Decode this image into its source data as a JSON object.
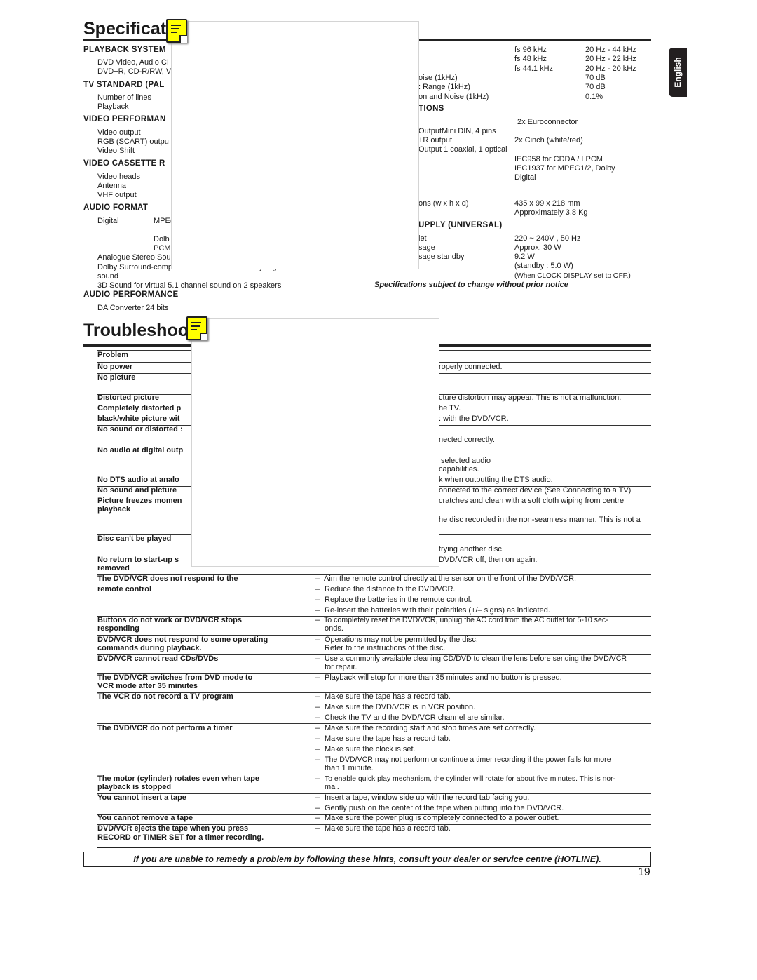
{
  "language_tab": "English",
  "specs": {
    "title": "Specificati",
    "left": [
      "PLAYBACK SYSTEM",
      "DVD Video, Audio CI",
      "DVD+R, CD-R/RW, V",
      "TV STANDARD (PAL",
      "Number of lines",
      "Playback",
      "VIDEO PERFORMAN",
      "Video output",
      "RGB (SCART) outpu",
      "Video Shift",
      "VIDEO CASSETTE R",
      "Video heads",
      "Antenna",
      "VHF output",
      "AUDIO FORMAT",
      "Digital",
      "MPE(",
      "Dolb",
      "PCM",
      "Analogue Stereo Sou",
      "Dolby Surround-compatible downmix from Dolby Digital multi channel",
      "sound",
      "3D Sound for virtual 5.1 channel sound on 2 speakers",
      "AUDIO PERFORMANCE",
      "DA Converter  24 bits"
    ],
    "right_labels": [
      "oise (1kHz)",
      ": Range (1kHz)",
      "on and Noise (1kHz)",
      "TIONS",
      "OutputMini DIN, 4 pins",
      "+R output",
      "Output  1 coaxial, 1 optical",
      "ons (w x h x d)",
      "UPPLY (UNIVERSAL)",
      "let",
      "sage",
      "sage standby"
    ],
    "values": [
      "fs 96 kHz",
      "fs 48 kHz",
      "fs 44.1 kHz",
      "20 Hz - 44 kHz",
      "20 Hz - 22 kHz",
      "20 Hz - 20 kHz",
      "70 dB",
      "70 dB",
      "0.1%",
      "2x Euroconnector",
      "2x Cinch (white/red)",
      "IEC958 for CDDA / LPCM",
      "IEC1937 for MPEG1/2, Dolby",
      "Digital",
      "435 x 99 x 218 mm",
      "Approximately 3.8 Kg",
      "220 ~ 240V , 50 Hz",
      "Approx. 30 W",
      "9.2 W",
      "(standby : 5.0 W)",
      "(When CLOCK DISPLAY set to OFF.)"
    ],
    "notice": "Specifications subject to change without prior notice"
  },
  "trouble": {
    "title": "Troubleshoot",
    "header": "Problem",
    "upper_problems": [
      "No power",
      "No picture",
      "Distorted picture",
      "Completely distorted p",
      "black/white picture wit",
      "No sound or distorted :",
      "No audio at digital outp",
      "No DTS audio at analo",
      "No sound and picture",
      "Picture freezes momen",
      "playback",
      "Disc can't be played",
      "No return to start-up s",
      "removed"
    ],
    "upper_solutions": [
      "roperly connected.",
      "cture distortion may appear. This is not a malfunction.",
      "he TV.",
      ": with the DVD/VCR.",
      "nected correctly.",
      "selected audio",
      "capabilities.",
      "k when outputting the DTS audio.",
      "onnected to the correct device (See Connecting to a TV)",
      "cratches and clean with a soft cloth wiping from centre",
      "he disc recorded in the non-seamless manner. This is not a",
      "trying another disc.",
      "DVD/VCR off, then on again."
    ],
    "lower_problems": [
      "The DVD/VCR does not respond to the",
      "remote control",
      "Buttons do not work or DVD/VCR stops",
      "responding",
      "DVD/VCR does not respond to some operating",
      "commands during playback.",
      "DVD/VCR cannot read CDs/DVDs",
      "The DVD/VCR switches from DVD mode to",
      "VCR mode after 35 minutes",
      "The VCR do not record a TV program",
      "The DVD/VCR do not perform a timer",
      "The motor (cylinder) rotates even when tape",
      "playback is stopped",
      "You cannot insert a tape",
      "You cannot remove a tape",
      "DVD/VCR ejects the tape when you press",
      "RECORD or TIMER SET for a timer recording."
    ],
    "lower_solutions": [
      "Aim the remote control directly at the sensor on the front of the DVD/VCR.",
      "Reduce the distance to the DVD/VCR.",
      "Replace the batteries in the remote control.",
      "Re-insert the batteries with their polarities (+/– signs) as indicated.",
      "To completely reset the DVD/VCR, unplug the AC cord from the AC outlet for 5-10 sec-",
      "onds.",
      "Operations may not be permitted by the disc.",
      "Refer to the instructions of the disc.",
      "Use a commonly available cleaning CD/DVD to clean the lens before sending the DVD/VCR",
      "for repair.",
      "Playback will stop for more than 35 minutes and no button is pressed.",
      "Make sure the tape has a record tab.",
      "Make sure the DVD/VCR is in VCR position.",
      "Check the TV and the DVD/VCR channel are similar.",
      "Make sure the recording start and stop times are set correctly.",
      "Make sure the tape has a record tab.",
      "Make sure the clock is set.",
      "The DVD/VCR may not perform or continue a timer recording if the power fails for more",
      "than 1 minute.",
      "To enable quick play mechanism, the cylinder  will  rotate for about five minutes. This is nor-",
      "mal.",
      "Insert a tape, window side up with the record tab facing you.",
      "Gently push on the center of the tape when putting into the DVD/VCR.",
      "Make sure the power plug is completely connected to a power outlet.",
      "Make sure the tape has a record tab."
    ],
    "dash": "–",
    "footer": "If you are unable to remedy a problem by following these hints, consult your dealer or service centre (HOTLINE)."
  },
  "page_number": "19",
  "colors": {
    "note_icon": "#ffff00",
    "tab_bg": "#231f20"
  }
}
